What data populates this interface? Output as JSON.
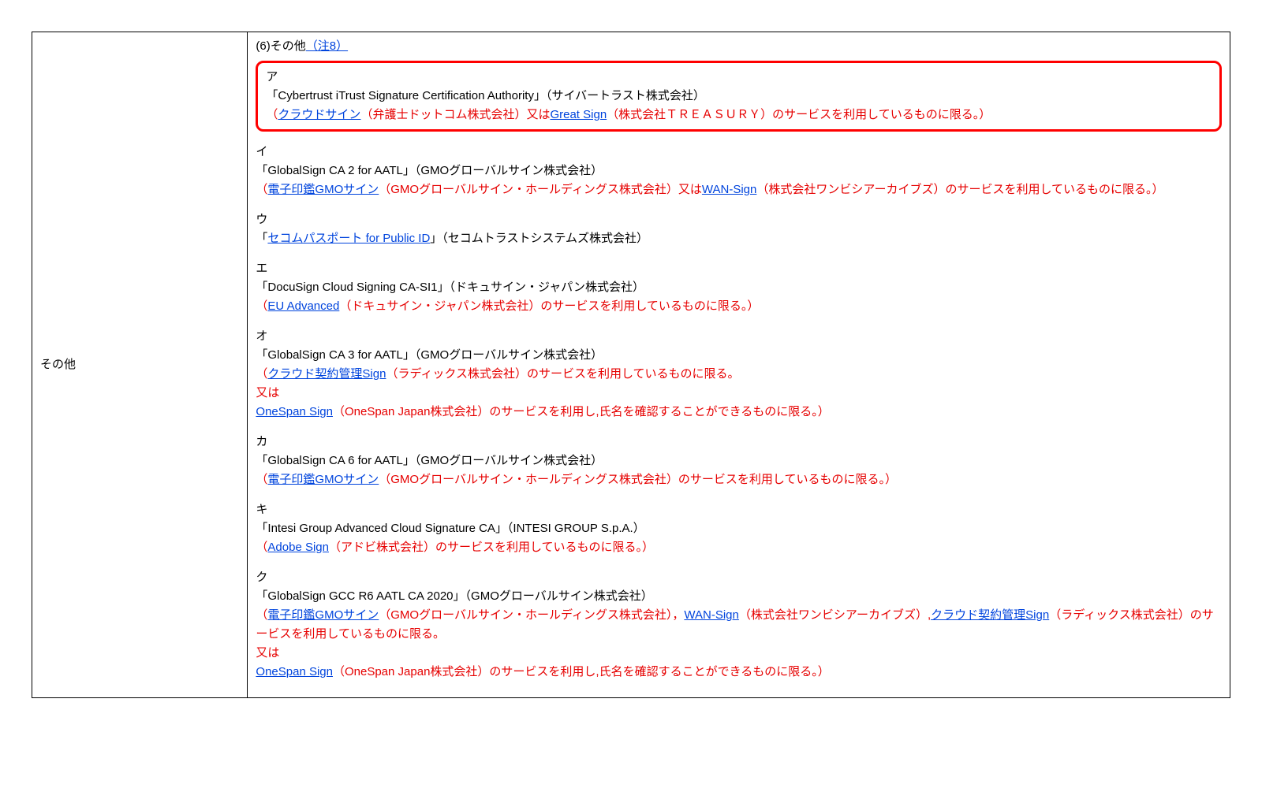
{
  "leftLabel": "その他",
  "topLine": {
    "prefix": "(6)その他",
    "noteLink": "（注8）"
  },
  "items": [
    {
      "key": "ア",
      "highlighted": true,
      "title": "「Cybertrust iTrust Signature Certification Authority」（サイバートラスト株式会社）",
      "runs": [
        {
          "text": "（",
          "class": "red"
        },
        {
          "text": "クラウドサイン",
          "class": "link"
        },
        {
          "text": "（弁護士ドットコム株式会社）又は",
          "class": "red"
        },
        {
          "text": "Great Sign",
          "class": "link"
        },
        {
          "text": "（株式会社ＴＲＥＡＳＵＲＹ）のサービスを利用しているものに限る。）",
          "class": "red"
        }
      ]
    },
    {
      "key": " イ",
      "title": "「GlobalSign CA 2 for AATL」（GMOグローバルサイン株式会社）",
      "runs": [
        {
          "text": "（",
          "class": "red"
        },
        {
          "text": "電子印鑑GMOサイン",
          "class": "link"
        },
        {
          "text": "（GMOグローバルサイン・ホールディングス株式会社）又は",
          "class": "red"
        },
        {
          "text": "WAN-Sign",
          "class": "link"
        },
        {
          "text": "（株式会社ワンビシアーカイブズ）のサービスを利用しているものに限る。）",
          "class": "red"
        }
      ]
    },
    {
      "key": "ウ",
      "title_runs": [
        {
          "text": "「",
          "class": ""
        },
        {
          "text": "セコムパスポート for Public ID",
          "class": "link"
        },
        {
          "text": "」（セコムトラストシステムズ株式会社）",
          "class": ""
        }
      ]
    },
    {
      "key": "エ",
      "title": "「DocuSign Cloud Signing CA-SI1」（ドキュサイン・ジャパン株式会社）",
      "runs": [
        {
          "text": "（",
          "class": "red"
        },
        {
          "text": "EU Advanced",
          "class": "link"
        },
        {
          "text": "（ドキュサイン・ジャパン株式会社）のサービスを利用しているものに限る。）",
          "class": "red"
        }
      ]
    },
    {
      "key": "オ",
      "title": "「GlobalSign CA 3 for AATL」（GMOグローバルサイン株式会社）",
      "runs": [
        {
          "text": "（",
          "class": "red"
        },
        {
          "text": "クラウド契約管理Sign",
          "class": "link"
        },
        {
          "text": "（ラディックス株式会社）のサービスを利用しているものに限る。",
          "class": "red"
        },
        {
          "text": "\n",
          "class": ""
        },
        {
          "text": "又は",
          "class": "red"
        },
        {
          "text": "\n",
          "class": ""
        },
        {
          "text": "OneSpan Sign",
          "class": "link"
        },
        {
          "text": "（OneSpan Japan株式会社）のサービスを利用し,氏名を確認することができるものに限る。）",
          "class": "red"
        }
      ]
    },
    {
      "key": "カ",
      "title": "「GlobalSign CA  6 for AATL」（GMOグローバルサイン株式会社）",
      "runs": [
        {
          "text": "（",
          "class": "red"
        },
        {
          "text": "電子印鑑GMOサイン",
          "class": "link"
        },
        {
          "text": "（GMOグローバルサイン・ホールディングス株式会社）のサービスを利用しているものに限る。）",
          "class": "red"
        }
      ]
    },
    {
      "key": "キ",
      "title": "「Intesi Group Advanced Cloud Signature CA」（INTESI GROUP S.p.A.）",
      "runs": [
        {
          "text": "（",
          "class": "red"
        },
        {
          "text": "Adobe Sign",
          "class": "link"
        },
        {
          "text": "（アドビ株式会社）のサービスを利用しているものに限る。）",
          "class": "red"
        }
      ]
    },
    {
      "key": "ク",
      "title": "「GlobalSign  GCC  R6 AATL CA 2020」（GMOグローバルサイン株式会社）",
      "runs": [
        {
          "text": "（",
          "class": "red"
        },
        {
          "text": "電子印鑑GMOサイン",
          "class": "link"
        },
        {
          "text": "（GMOグローバルサイン・ホールディングス株式会社），",
          "class": "red"
        },
        {
          "text": "WAN-Sign",
          "class": "link"
        },
        {
          "text": "（株式会社ワンビシアーカイブズ）,",
          "class": "red"
        },
        {
          "text": "クラウド契約管理Sign",
          "class": "link"
        },
        {
          "text": "（ラディックス株式会社）のサービスを利用しているものに限る。",
          "class": "red"
        },
        {
          "text": "\n",
          "class": ""
        },
        {
          "text": "又は",
          "class": "red"
        },
        {
          "text": "\n",
          "class": ""
        },
        {
          "text": "OneSpan Sign",
          "class": "link"
        },
        {
          "text": "（OneSpan Japan株式会社）のサービスを利用し,氏名を確認することができるものに限る。）",
          "class": "red"
        }
      ]
    }
  ]
}
